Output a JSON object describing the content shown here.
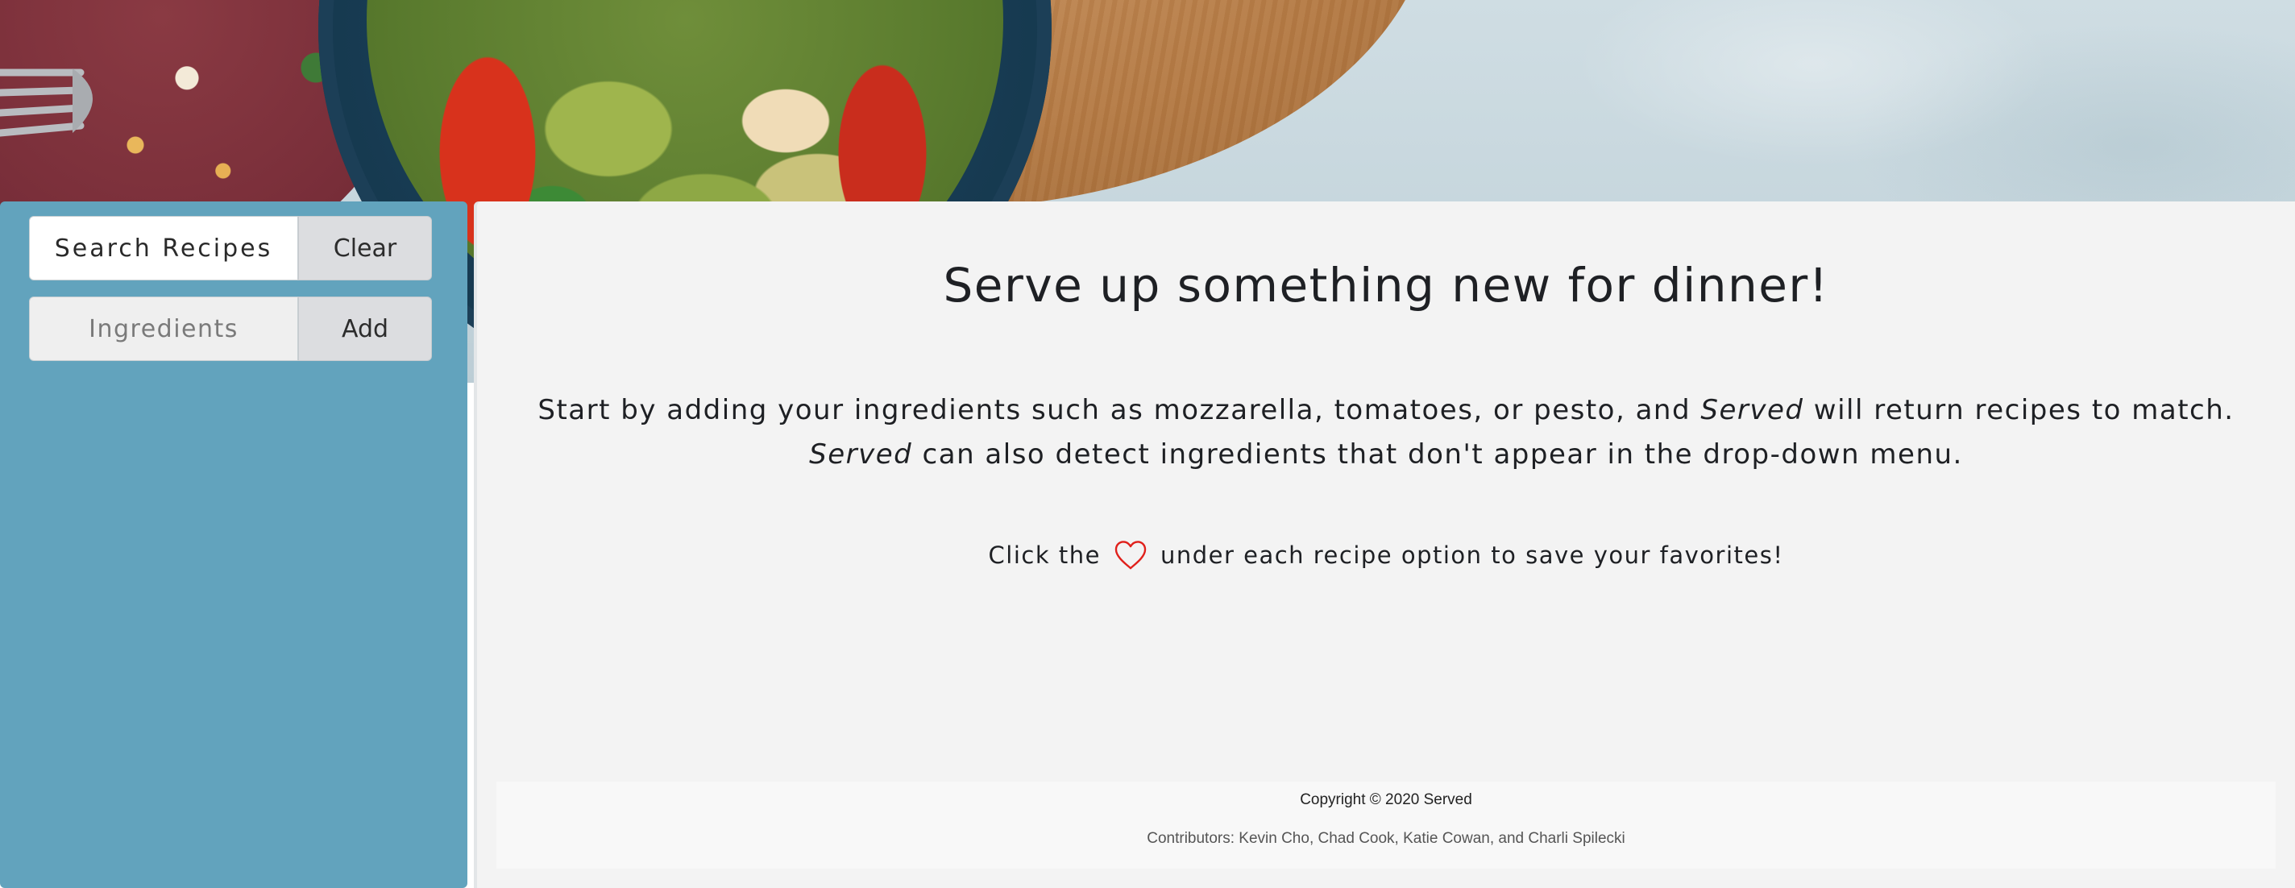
{
  "hero": {
    "image_icon": "food-photo-icon"
  },
  "sidebar": {
    "search_field": "Search Recipes",
    "clear_button": "Clear",
    "ingredients_placeholder": "Ingredients",
    "add_button": "Add"
  },
  "main": {
    "title": "Serve up something new for dinner!",
    "intro_line1_pre": "Start by adding your ingredients such as mozzarella, tomatoes, or pesto, and ",
    "brand": "Served",
    "intro_line1_post": " will return recipes to match.",
    "intro_line2_post": " can also detect ingredients that don't appear in the drop-down menu.",
    "hint_pre": "Click the",
    "hint_icon": "heart-icon",
    "hint_post": "under each recipe option to save your favorites!"
  },
  "footer": {
    "copyright": "Copyright © 2020 Served",
    "contributors": "Contributors: Kevin Cho, Chad Cook, Katie Cowan, and Charli Spilecki"
  },
  "colors": {
    "sidebar": "#62a3bd",
    "panel": "#f3f3f3",
    "heart": "#e0201b",
    "button": "#dcdde0"
  }
}
